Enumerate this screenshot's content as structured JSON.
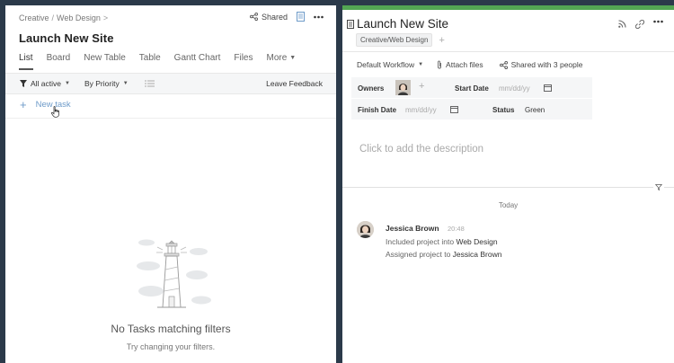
{
  "left": {
    "breadcrumb": [
      "Creative",
      "Web Design"
    ],
    "breadcrumb_sep": "/",
    "breadcrumb_trail": ">",
    "shared_label": "Shared",
    "title": "Launch New Site",
    "tabs": [
      "List",
      "Board",
      "New Table",
      "Table",
      "Gantt Chart",
      "Files",
      "More"
    ],
    "filters": {
      "status": "All active",
      "sort": "By Priority",
      "feedback": "Leave Feedback"
    },
    "new_task": "New task",
    "empty_title": "No Tasks matching filters",
    "empty_subtitle": "Try changing your filters."
  },
  "right": {
    "title": "Launch New Site",
    "tag": "Creative/Web Design",
    "tag_add": "+",
    "workflow": "Default Workflow",
    "attach": "Attach files",
    "shared_with": "Shared with 3 people",
    "owners_label": "Owners",
    "owners_add": "+",
    "start_date_label": "Start Date",
    "start_date_placeholder": "mm/dd/yy",
    "finish_date_label": "Finish Date",
    "finish_date_placeholder": "mm/dd/yy",
    "status_label": "Status",
    "status_value": "Green",
    "description_placeholder": "Click to add the description",
    "day_label": "Today",
    "activity": {
      "user": "Jessica Brown",
      "time": "20:48",
      "line1_prefix": "Included project into",
      "line1_target": "Web Design",
      "line2_prefix": "Assigned project to",
      "line2_target": "Jessica Brown"
    }
  },
  "colors": {
    "accent_green": "#53a653",
    "link_blue": "#6e9bc9",
    "frame": "#2b3a4a"
  },
  "icons": [
    "share-icon",
    "document-icon",
    "more-icon",
    "filter-icon",
    "list-icon",
    "plus-icon",
    "rss-icon",
    "link-icon",
    "paperclip-icon",
    "calendar-icon",
    "funnel-icon"
  ]
}
